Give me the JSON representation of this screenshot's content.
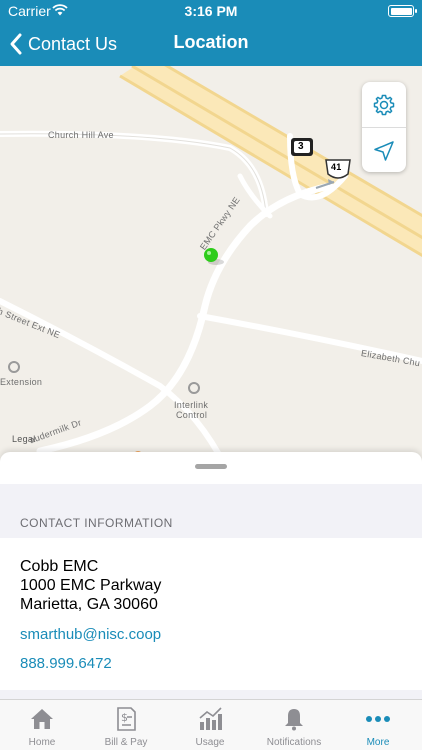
{
  "status_bar": {
    "carrier": "Carrier",
    "time": "3:16 PM"
  },
  "nav": {
    "back_label": "Contact Us",
    "title": "Location"
  },
  "map": {
    "labels": {
      "church_hill": "Church Hill Ave",
      "emc_pkwy": "EMC Pkwy NE",
      "street_ext": "h Street Ext NE",
      "elizabeth": "Elizabeth Chu",
      "extension": "Extension",
      "interlink_1": "Interlink",
      "interlink_2": "Control",
      "gaudermilk": "audermilk Dr",
      "legal": "Legal",
      "route_3": "3",
      "route_41": "41"
    },
    "controls": {
      "settings_icon": "gear-icon",
      "locate_icon": "location-arrow-icon"
    },
    "pin_color": "#2ecc1a"
  },
  "contact": {
    "section_header": "CONTACT INFORMATION",
    "name": "Cobb EMC",
    "street": "1000 EMC Parkway",
    "city": "Marietta, GA 30060",
    "email": "smarthub@nisc.coop",
    "phone": "888.999.6472"
  },
  "tabs": [
    {
      "label": "Home",
      "icon": "home-icon"
    },
    {
      "label": "Bill & Pay",
      "icon": "bill-icon"
    },
    {
      "label": "Usage",
      "icon": "usage-chart-icon"
    },
    {
      "label": "Notifications",
      "icon": "bell-icon"
    },
    {
      "label": "More",
      "icon": "more-dots-icon",
      "active": true
    }
  ],
  "colors": {
    "brand": "#1a8cb8",
    "tab_inactive": "#8e8e93",
    "map_bg": "#f2efe9"
  }
}
